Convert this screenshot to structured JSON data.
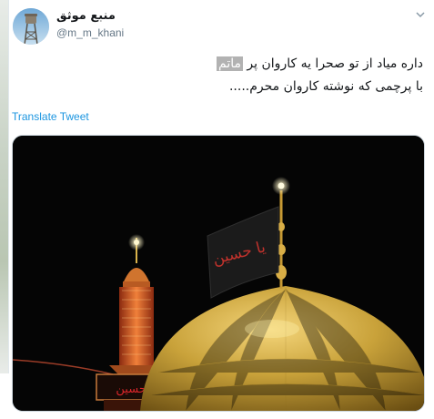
{
  "tweet": {
    "author_name": "منبع موثق",
    "handle": "@m_m_khani",
    "text_line1_before": "داره میاد از تو صحرا یه کاروان پر ",
    "text_line1_highlight": "ماتم",
    "text_line2": "با پرچمی که نوشته کاروان محرم.....",
    "translate_label": "Translate Tweet",
    "menu_icon": "chevron-down-icon",
    "avatar_icon": "water-tower-icon"
  },
  "image": {
    "flag_text": "یا حسین",
    "minaret_text": "یا حسین",
    "colors": {
      "dome": "#c9a23a",
      "minaret": "#e0632a",
      "flag": "#1b1b1b",
      "flag_text": "#c0322c"
    }
  },
  "colors": {
    "link": "#1b95e0",
    "text": "#14171a",
    "secondary": "#657786",
    "highlight": "#b2b2b2"
  }
}
